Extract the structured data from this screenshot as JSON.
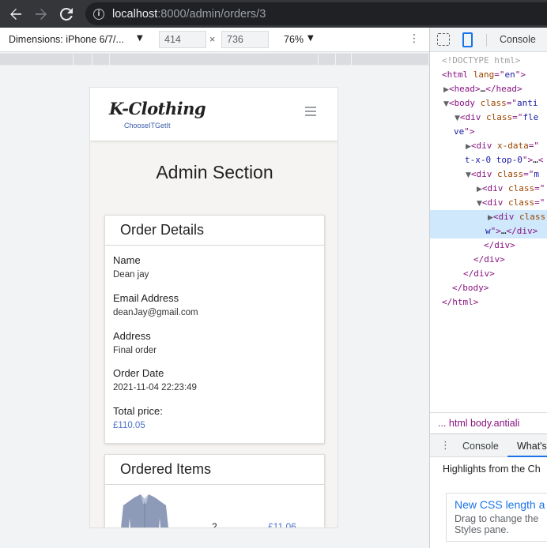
{
  "browser": {
    "url_host": "localhost",
    "url_path": ":8000/admin/orders/3"
  },
  "device_toolbar": {
    "dimensions_label": "Dimensions: iPhone 6/7/...",
    "width": "414",
    "height": "736",
    "times": "×",
    "zoom": "76%"
  },
  "site": {
    "logo_main": "K-Clothing",
    "logo_sub": "ChooseITGetIt",
    "section_title": "Admin Section"
  },
  "order_details": {
    "heading": "Order Details",
    "fields": [
      {
        "label": "Name",
        "value": "Dean jay"
      },
      {
        "label": "Email Address",
        "value": "deanJay@gmail.com"
      },
      {
        "label": "Address",
        "value": "Final order"
      },
      {
        "label": "Order Date",
        "value": "2021-11-04 22:23:49"
      },
      {
        "label": "Total price:",
        "value": "£110.05"
      }
    ]
  },
  "ordered_items": {
    "heading": "Ordered Items",
    "items": [
      {
        "quantity": "2",
        "price": "£11.06"
      }
    ]
  },
  "devtools": {
    "console_tab": "Console",
    "breadcrumb": "...   html   body.antiali",
    "drawer_console": "Console",
    "drawer_whats_new": "What's",
    "highlights": "Highlights from the Ch",
    "news_title": "New CSS length a",
    "news_text_1": "Drag to change the",
    "news_text_2": "Styles pane."
  },
  "colors": {
    "link_blue": "#4a70c9",
    "devtools_blue": "#1a73e8",
    "tag_purple": "#881280"
  }
}
